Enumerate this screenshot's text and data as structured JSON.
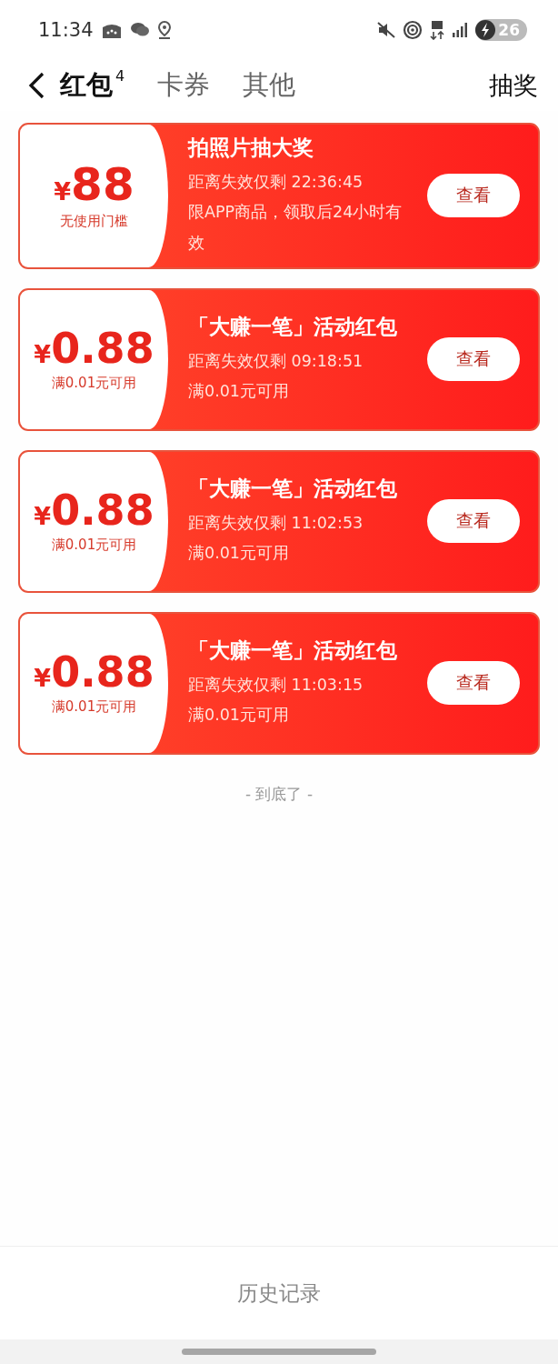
{
  "status_bar": {
    "time": "11:34",
    "battery": "26"
  },
  "nav": {
    "tabs": [
      {
        "label": "红包",
        "badge": "4",
        "selected": true
      },
      {
        "label": "卡券",
        "selected": false
      },
      {
        "label": "其他",
        "selected": false
      }
    ],
    "action": "抽奖"
  },
  "coupons": [
    {
      "currency": "¥",
      "amount": "88",
      "condition": "无使用门槛",
      "title": "拍照片抽大奖",
      "countdown": "距离失效仅剩 22:36:45",
      "note": "限APP商品，领取后24小时有效",
      "button": "查看"
    },
    {
      "currency": "¥",
      "amount": "0.88",
      "condition": "满0.01元可用",
      "title": "「大赚一笔」活动红包",
      "countdown": "距离失效仅剩 09:18:51",
      "note": "满0.01元可用",
      "button": "查看"
    },
    {
      "currency": "¥",
      "amount": "0.88",
      "condition": "满0.01元可用",
      "title": "「大赚一笔」活动红包",
      "countdown": "距离失效仅剩 11:02:53",
      "note": "满0.01元可用",
      "button": "查看"
    },
    {
      "currency": "¥",
      "amount": "0.88",
      "condition": "满0.01元可用",
      "title": "「大赚一笔」活动红包",
      "countdown": "距离失效仅剩 11:03:15",
      "note": "满0.01元可用",
      "button": "查看"
    }
  ],
  "end_text": "- 到底了 -",
  "footer": {
    "button": "历史记录"
  }
}
